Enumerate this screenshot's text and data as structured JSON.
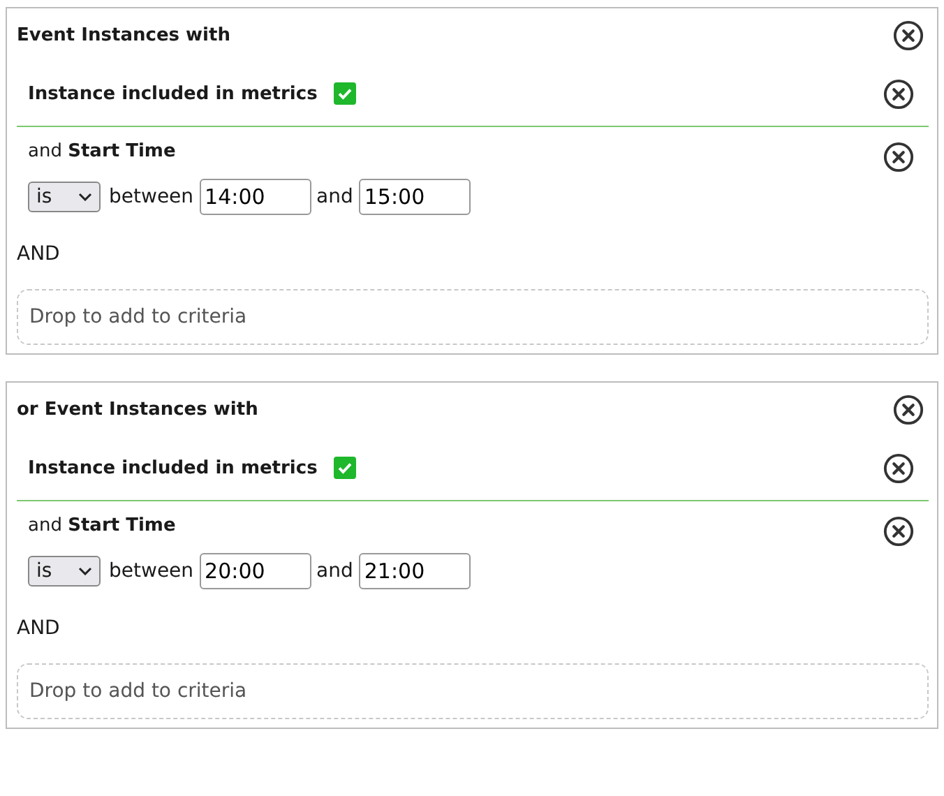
{
  "groups": [
    {
      "title": "Event Instances with",
      "criteria": [
        {
          "kind": "checkbox",
          "label": "Instance included in metrics",
          "checked": true
        },
        {
          "kind": "range",
          "prefix": "and",
          "field": "Start Time",
          "operator": "is",
          "between": "between",
          "from": "14:00",
          "joiner": "and",
          "to": "15:00"
        }
      ],
      "logic": "AND",
      "drop_zone": "Drop to add to criteria"
    },
    {
      "title": "or Event Instances with",
      "criteria": [
        {
          "kind": "checkbox",
          "label": "Instance included in metrics",
          "checked": true
        },
        {
          "kind": "range",
          "prefix": "and",
          "field": "Start Time",
          "operator": "is",
          "between": "between",
          "from": "20:00",
          "joiner": "and",
          "to": "21:00"
        }
      ],
      "logic": "AND",
      "drop_zone": "Drop to add to criteria"
    }
  ]
}
